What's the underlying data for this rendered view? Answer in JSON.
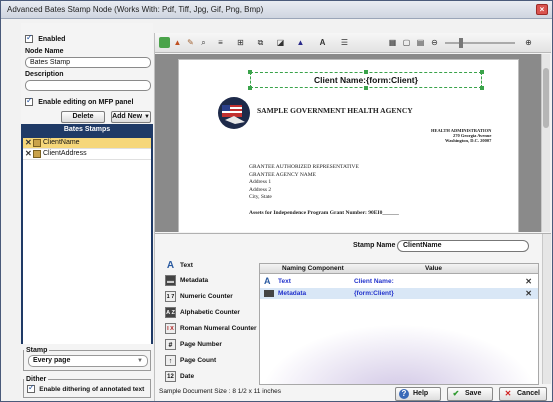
{
  "window": {
    "title": "Advanced Bates Stamp Node   (Works With: Pdf, Tiff, Jpg, Gif, Png, Bmp)",
    "close_glyph": "×"
  },
  "left_panel": {
    "enabled_label": "Enabled",
    "node_name_label": "Node Name",
    "node_name_value": "Bates Stamp",
    "description_label": "Description",
    "description_value": "",
    "enable_editing_label": "Enable editing on MFP panel",
    "delete_label": "Delete",
    "add_new_label": "Add New",
    "bates_stamps_heading": "Bates Stamps",
    "stamps": [
      {
        "label": "ClientName",
        "selected": true
      },
      {
        "label": "ClientAddress",
        "selected": false
      }
    ],
    "stamp_group_label": "Stamp",
    "stamp_select_value": "Every page",
    "dither_group_label": "Dither",
    "dither_label": "Enable dithering of annotated text"
  },
  "preview": {
    "stamp_text": "Client Name:{form:Client}",
    "agency_name": "SAMPLE GOVERNMENT HEALTH AGENCY",
    "addr_lines": [
      "HEALTH ADMINISTRATION",
      "270 Georgia Avenue",
      "Washington, D.C. 20007"
    ],
    "body_lines": [
      "GRANTEE AUTHORIZED REPRESENTATIVE",
      "GRANTEE AGENCY NAME",
      "Address 1",
      "Address 2",
      "City, State"
    ],
    "assets_line": "Assets for Independence Program Grant Number:  90EI0______"
  },
  "editor": {
    "stamp_name_label": "Stamp Name",
    "stamp_name_value": "ClientName",
    "palette": [
      {
        "label": "Text",
        "icon": "A"
      },
      {
        "label": "Metadata",
        "icon": "▬"
      },
      {
        "label": "Numeric Counter",
        "icon": "1 7"
      },
      {
        "label": "Alphabetic Counter",
        "icon": "A Z"
      },
      {
        "label": "Roman Numeral Counter",
        "icon": "I X"
      },
      {
        "label": "Page Number",
        "icon": "#"
      },
      {
        "label": "Page Count",
        "icon": "↑"
      },
      {
        "label": "Date",
        "icon": "12"
      }
    ],
    "columns": [
      "Naming Component",
      "Value"
    ],
    "rows": [
      {
        "component": "Text",
        "value": "Client Name:",
        "selected": false
      },
      {
        "component": "Metadata",
        "value": "{form:Client}",
        "selected": true
      }
    ],
    "row_remove_glyph": "✕"
  },
  "footer": {
    "doc_size": "Sample Document Size : 8 1/2 x 11 inches",
    "help_label": "Help",
    "save_label": "Save",
    "cancel_label": "Cancel"
  },
  "colors": {
    "accent_blue": "#1f3a66",
    "selected_row": "#f6d77a",
    "stamp_border": "#3aa34a",
    "link_blue": "#2233cc"
  }
}
